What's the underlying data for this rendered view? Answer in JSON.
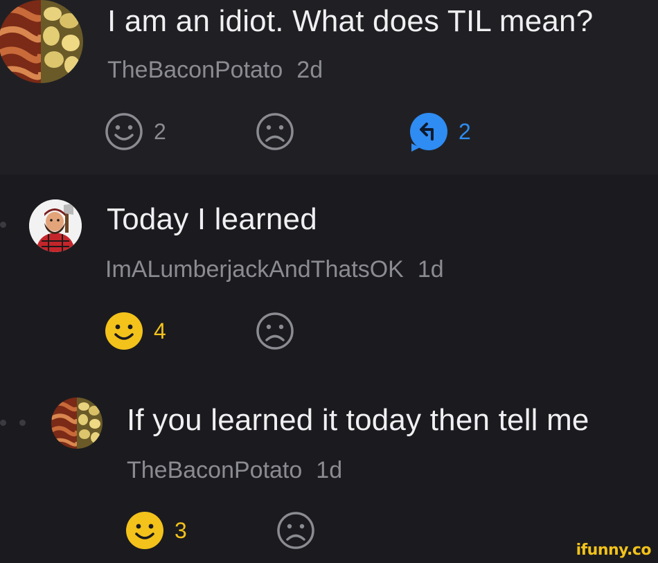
{
  "comments": [
    {
      "text": "I am an idiot. What does TIL mean?",
      "author": "TheBaconPotato",
      "time": "2d",
      "smile_count": "2",
      "reply_count": "2",
      "avatar": "bacon-potato-icon"
    },
    {
      "text": "Today I learned",
      "author": "ImALumberjackAndThatsOK",
      "time": "1d",
      "smile_count": "4",
      "avatar": "lumberjack-icon"
    },
    {
      "text": "If you learned it today then tell me",
      "author": "TheBaconPotato",
      "time": "1d",
      "smile_count": "3",
      "avatar": "bacon-potato-icon"
    }
  ],
  "watermark": "ifunny.co",
  "colors": {
    "background": "#1b1b1f",
    "highlight": "#202024",
    "smile_active": "#f3c21b",
    "reply_blue": "#2f8cf2",
    "muted": "#8b8b92"
  }
}
